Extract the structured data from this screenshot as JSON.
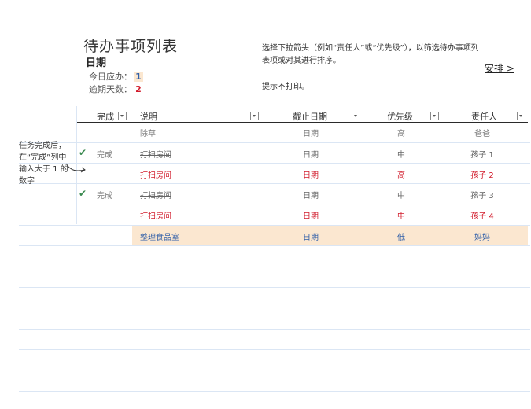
{
  "header": {
    "title": "待办事项列表",
    "date_label": "日期",
    "due_today_label": "今日应办：",
    "due_today_value": "1",
    "overdue_label": "逾期天数：",
    "overdue_value": "2",
    "instructions": "选择下拉箭头（例如“责任人”或“优先级”），以筛选待办事项列表项或对其进行排序。",
    "no_print": "提示不打印。",
    "arrange_link": "安排 >"
  },
  "table": {
    "columns": [
      "完成",
      "说明",
      "截止日期",
      "优先级",
      "责任人"
    ],
    "rows": [
      {
        "done": "",
        "check": "",
        "desc": "除草",
        "date": "日期",
        "priority": "高",
        "owner": "爸爸",
        "style": "gray"
      },
      {
        "done": "完成",
        "check": "✔",
        "desc": "打扫房间",
        "date": "日期",
        "priority": "中",
        "owner": "孩子 1",
        "style": "strike"
      },
      {
        "done": "",
        "check": "",
        "desc": "打扫房间",
        "date": "日期",
        "priority": "高",
        "owner": "孩子 2",
        "style": "red"
      },
      {
        "done": "完成",
        "check": "✔",
        "desc": "打扫房间",
        "date": "日期",
        "priority": "中",
        "owner": "孩子 3",
        "style": "strike"
      },
      {
        "done": "",
        "check": "",
        "desc": "打扫房间",
        "date": "日期",
        "priority": "中",
        "owner": "孩子 4",
        "style": "red"
      },
      {
        "done": "",
        "check": "",
        "desc": "整理食品室",
        "date": "日期",
        "priority": "低",
        "owner": "妈妈",
        "style": "blue"
      }
    ]
  },
  "side_note": "任务完成后，在“完成”列中输入大于 1 的数字",
  "colors": {
    "accent_red": "#d11a2a",
    "accent_blue": "#2f5ea8",
    "highlight": "#fbe7d0",
    "check_green": "#3a8a50"
  },
  "icons": {
    "dropdown": "dropdown-arrow-icon",
    "check": "checkmark-icon",
    "note_arrow": "curved-arrow-icon"
  }
}
